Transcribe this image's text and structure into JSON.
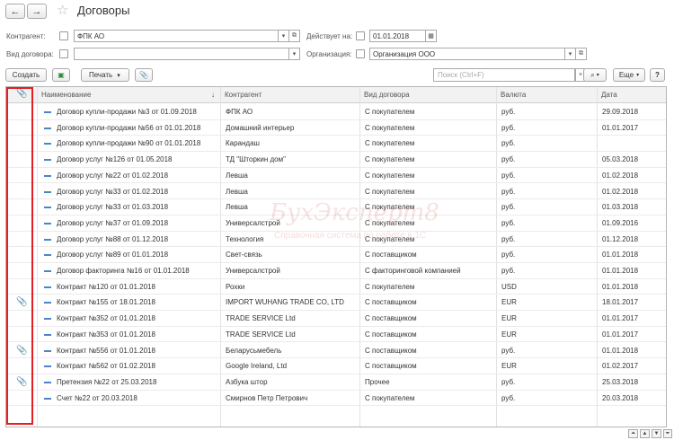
{
  "window": {
    "title": "Договоры",
    "back_icon": "arrow-left-icon",
    "forward_icon": "arrow-right-icon",
    "favorite_icon": "star-icon"
  },
  "filters": {
    "counterparty_label": "Контрагент:",
    "counterparty_value": "ФПК АО",
    "effective_label": "Действует на:",
    "effective_value": "01.01.2018",
    "contract_type_label": "Вид договора:",
    "contract_type_value": "",
    "organization_label": "Организация:",
    "organization_value": "Организация ООО"
  },
  "toolbar": {
    "create_label": "Создать",
    "print_label": "Печать",
    "search_placeholder": "Поиск (Ctrl+F)",
    "more_label": "Еще",
    "help_label": "?"
  },
  "table": {
    "columns": [
      "Наименование",
      "Контрагент",
      "Вид договора",
      "Валюта",
      "Дата"
    ],
    "sort_indicator": "↓",
    "rows": [
      {
        "attach": false,
        "name": "Договор купли-продажи №3 от 01.09.2018",
        "counterparty": "ФПК АО",
        "type": "С покупателем",
        "currency": "руб.",
        "date": "29.09.2018"
      },
      {
        "attach": false,
        "name": "Договор купли-продажи №56 от 01.01.2018",
        "counterparty": "Домашний интерьер",
        "type": "С покупателем",
        "currency": "руб.",
        "date": "01.01.2017"
      },
      {
        "attach": false,
        "name": "Договор купли-продажи №90 от 01.01.2018",
        "counterparty": "Карандаш",
        "type": "С покупателем",
        "currency": "руб.",
        "date": ""
      },
      {
        "attach": false,
        "name": "Договор услуг №126 от 01.05.2018",
        "counterparty": "ТД \"Шторкин дом\"",
        "type": "С покупателем",
        "currency": "руб.",
        "date": "05.03.2018"
      },
      {
        "attach": false,
        "name": "Договор услуг №22 от 01.02.2018",
        "counterparty": "Левша",
        "type": "С покупателем",
        "currency": "руб.",
        "date": "01.02.2018"
      },
      {
        "attach": false,
        "name": "Договор услуг №33 от 01.02.2018",
        "counterparty": "Левша",
        "type": "С покупателем",
        "currency": "руб.",
        "date": "01.02.2018"
      },
      {
        "attach": false,
        "name": "Договор услуг №33 от 01.03.2018",
        "counterparty": "Левша",
        "type": "С покупателем",
        "currency": "руб.",
        "date": "01.03.2018"
      },
      {
        "attach": false,
        "name": "Договор услуг №37 от 01.09.2018",
        "counterparty": "Универсалстрой",
        "type": "С покупателем",
        "currency": "руб.",
        "date": "01.09.2016"
      },
      {
        "attach": false,
        "name": "Договор услуг №88 от 01.12.2018",
        "counterparty": "Технология",
        "type": "С покупателем",
        "currency": "руб.",
        "date": "01.12.2018"
      },
      {
        "attach": false,
        "name": "Договор услуг №89 от 01.01.2018",
        "counterparty": "Свет-связь",
        "type": "С поставщиком",
        "currency": "руб.",
        "date": "01.01.2018"
      },
      {
        "attach": false,
        "name": "Договор факторинга №16 от 01.01.2018",
        "counterparty": "Универсалстрой",
        "type": "С факторинговой компанией",
        "currency": "руб.",
        "date": "01.01.2018"
      },
      {
        "attach": false,
        "name": "Контракт №120 от 01.01.2018",
        "counterparty": "Рохки",
        "type": "С покупателем",
        "currency": "USD",
        "date": "01.01.2018"
      },
      {
        "attach": true,
        "name": "Контракт №155 от 18.01.2018",
        "counterparty": "IMPORT WUHANG TRADE CO, LTD",
        "type": "С поставщиком",
        "currency": "EUR",
        "date": "18.01.2017"
      },
      {
        "attach": false,
        "name": "Контракт №352 от 01.01.2018",
        "counterparty": "TRADE SERVICE Ltd",
        "type": "С поставщиком",
        "currency": "EUR",
        "date": "01.01.2017"
      },
      {
        "attach": false,
        "name": "Контракт №353 от 01.01.2018",
        "counterparty": "TRADE SERVICE Ltd",
        "type": "С поставщиком",
        "currency": "EUR",
        "date": "01.01.2017"
      },
      {
        "attach": true,
        "name": "Контракт №556 от 01.01.2018",
        "counterparty": "Беларусьмебель",
        "type": "С поставщиком",
        "currency": "руб.",
        "date": "01.01.2018"
      },
      {
        "attach": false,
        "name": "Контракт №562 от 01.02.2018",
        "counterparty": "Google Ireland, Ltd",
        "type": "С поставщиком",
        "currency": "EUR",
        "date": "01.02.2017"
      },
      {
        "attach": true,
        "name": "Претензия №22 от 25.03.2018",
        "counterparty": "Азбука штор",
        "type": "Прочее",
        "currency": "руб.",
        "date": "25.03.2018"
      },
      {
        "attach": false,
        "name": "Счет №22 от 20.03.2018",
        "counterparty": "Смирнов Петр Петрович",
        "type": "С покупателем",
        "currency": "руб.",
        "date": "20.03.2018"
      }
    ]
  },
  "watermark": {
    "brand": "БухЭксперт8",
    "tagline": "Справочная система по работе в 1С"
  },
  "colors": {
    "highlight": "#e31e24",
    "row_marker": "#4a86c5"
  }
}
